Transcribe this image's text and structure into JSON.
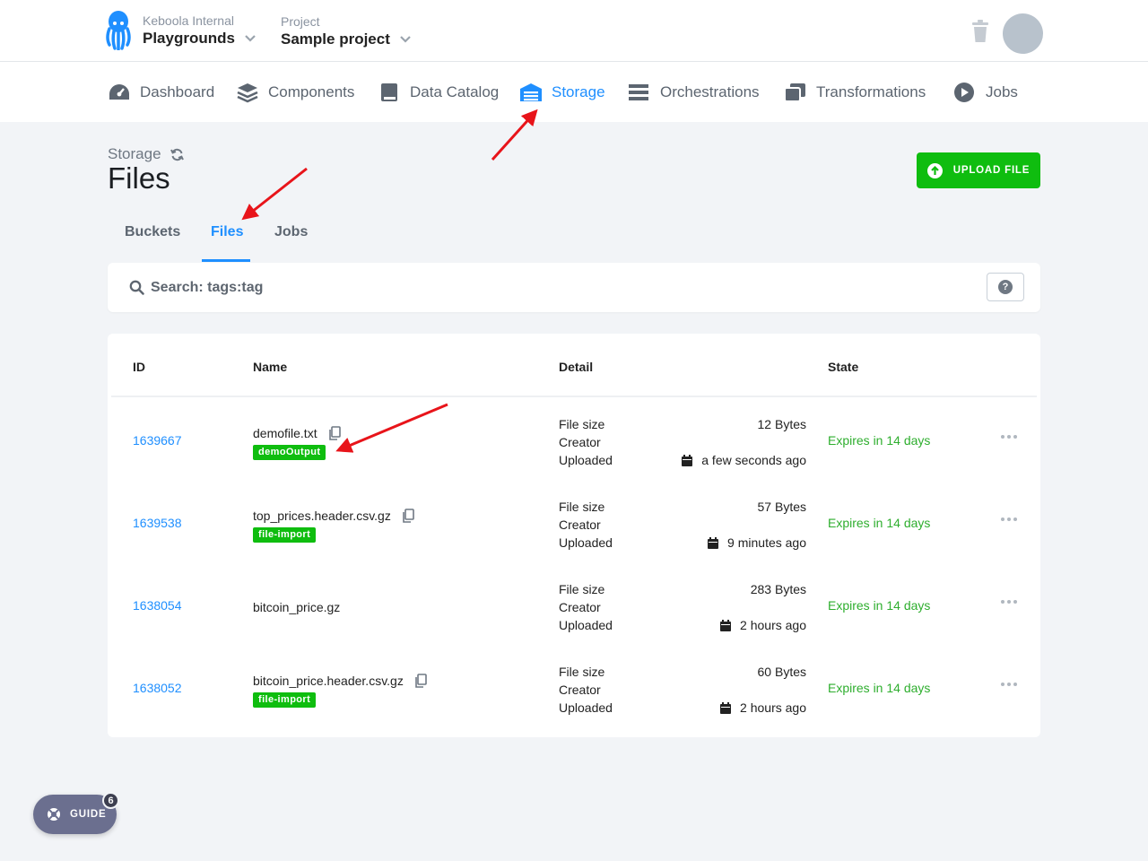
{
  "topbar": {
    "org_label": "Keboola Internal",
    "org_value": "Playgrounds",
    "project_label": "Project",
    "project_value": "Sample project"
  },
  "nav": {
    "items": [
      {
        "label": "Dashboard",
        "icon": "gauge-icon"
      },
      {
        "label": "Components",
        "icon": "layers-icon"
      },
      {
        "label": "Data Catalog",
        "icon": "book-icon"
      },
      {
        "label": "Storage",
        "icon": "warehouse-icon",
        "active": true
      },
      {
        "label": "Orchestrations",
        "icon": "bars-icon"
      },
      {
        "label": "Transformations",
        "icon": "cards-icon"
      },
      {
        "label": "Jobs",
        "icon": "play-circle-icon"
      }
    ]
  },
  "header": {
    "breadcrumb": "Storage",
    "title": "Files",
    "upload_label": "UPLOAD FILE"
  },
  "tabs": [
    "Buckets",
    "Files",
    "Jobs"
  ],
  "active_tab": "Files",
  "search": {
    "placeholder": "Search: tags:tag"
  },
  "table": {
    "headers": [
      "ID",
      "Name",
      "Detail",
      "State"
    ],
    "detail_labels": [
      "File size",
      "Creator",
      "Uploaded"
    ],
    "rows": [
      {
        "id": "1639667",
        "name": "demofile.txt",
        "tag": "demoOutput",
        "size": "12 Bytes",
        "creator": "",
        "uploaded": "a few seconds ago",
        "state": "Expires in 14 days"
      },
      {
        "id": "1639538",
        "name": "top_prices.header.csv.gz",
        "tag": "file-import",
        "size": "57 Bytes",
        "creator": "",
        "uploaded": "9 minutes ago",
        "state": "Expires in 14 days"
      },
      {
        "id": "1638054",
        "name": "bitcoin_price.gz",
        "tag": "",
        "size": "283 Bytes",
        "creator": "",
        "uploaded": "2 hours ago",
        "state": "Expires in 14 days"
      },
      {
        "id": "1638052",
        "name": "bitcoin_price.header.csv.gz",
        "tag": "file-import",
        "size": "60 Bytes",
        "creator": "",
        "uploaded": "2 hours ago",
        "state": "Expires in 14 days"
      }
    ]
  },
  "guide": {
    "label": "GUIDE",
    "count": "6"
  },
  "colors": {
    "accent": "#1f8fff",
    "success": "#0fbd0f",
    "state_text": "#2eae2e",
    "annotation": "#e8141a"
  }
}
